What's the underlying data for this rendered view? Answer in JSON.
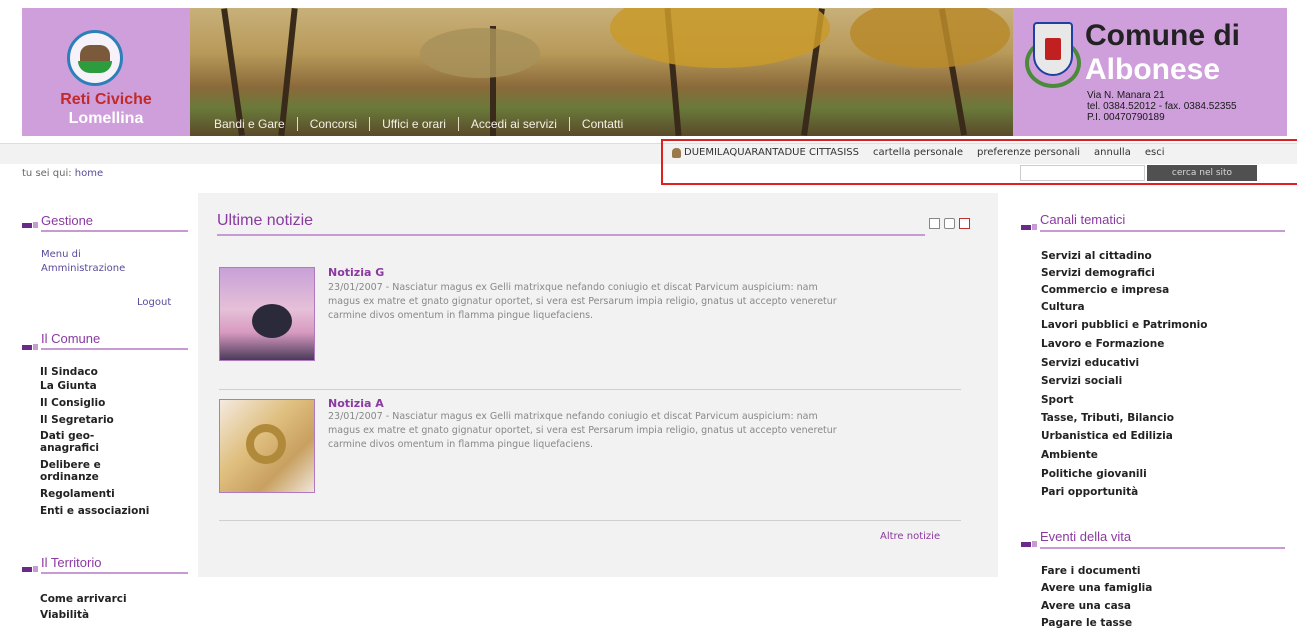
{
  "brand": {
    "name_line1": "Reti Civiche",
    "name_line2": "Lomellina"
  },
  "nav": [
    "Bandi e Gare",
    "Concorsi",
    "Uffici e orari",
    "Accedi ai servizi",
    "Contatti"
  ],
  "comune": {
    "title": "Comune di",
    "name": "Albonese",
    "address": "Via N. Manara 21",
    "phone": "tel. 0384.52012 - fax. 0384.52355",
    "piva": "P.I. 00470790189"
  },
  "userbar": {
    "username": "DUEMILAQUARANTADUE CITTASISS",
    "links": [
      "cartella personale",
      "preferenze personali",
      "annulla",
      "esci"
    ]
  },
  "breadcrumb": {
    "prefix": "tu sei qui:",
    "current": "home"
  },
  "search": {
    "button": "cerca nel sito",
    "value": ""
  },
  "sidebar_left": {
    "gestione": {
      "title": "Gestione",
      "items": [
        "Menu di",
        "Amministrazione"
      ],
      "logout": "Logout"
    },
    "comune": {
      "title": "Il Comune",
      "items": [
        "Il Sindaco",
        "La Giunta",
        "Il Consiglio",
        "Il Segretario",
        "Dati geo-",
        "anagrafici",
        "Delibere e",
        "ordinanze",
        "Regolamenti",
        "Enti e associazioni"
      ]
    },
    "territorio": {
      "title": "Il Territorio",
      "items": [
        "Come arrivarci",
        "Viabilità"
      ]
    }
  },
  "main": {
    "title": "Ultime notizie",
    "news": [
      {
        "title": "Notizia G",
        "date": "23/01/2007",
        "text_line1": "23/01/2007 - Nasciatur magus ex Gelli matrixque nefando coniugio et discat Parvicum auspicium: nam",
        "text_line2": "magus ex matre et gnato gignatur oportet, si vera est Persarum impia religio, gnatus ut accepto veneretur",
        "text_line3": "carmine divos omentum in flamma pingue liquefaciens."
      },
      {
        "title": "Notizia A",
        "date": "23/01/2007",
        "text_line1": "23/01/2007 - Nasciatur magus ex Gelli matrixque nefando coniugio et discat Parvicum auspicium: nam",
        "text_line2": "magus ex matre et gnato gignatur oportet, si vera est Persarum impia religio, gnatus ut accepto veneretur",
        "text_line3": "carmine divos omentum in flamma pingue liquefaciens."
      }
    ],
    "more": "Altre notizie"
  },
  "sidebar_right": {
    "canali": {
      "title": "Canali tematici",
      "items": [
        "Servizi al cittadino",
        "Servizi demografici",
        "Commercio e impresa",
        "Cultura",
        "Lavori pubblici e Patrimonio",
        "Lavoro e Formazione",
        "Servizi educativi",
        "Servizi sociali",
        "Sport",
        "Tasse, Tributi, Bilancio",
        "Urbanistica ed Edilizia",
        "Ambiente",
        "Politiche giovanili",
        "Pari opportunità"
      ]
    },
    "eventi": {
      "title": "Eventi della vita",
      "items": [
        "Fare i documenti",
        "Avere una famiglia",
        "Avere una casa",
        "Pagare le tasse"
      ]
    }
  },
  "colors": {
    "accent": "#8a3aa0",
    "brand_bg": "#cf9fdc",
    "highlight": "#e02020"
  },
  "icons": [
    "user-icon",
    "print-icon",
    "pdf-icon",
    "email-icon"
  ]
}
